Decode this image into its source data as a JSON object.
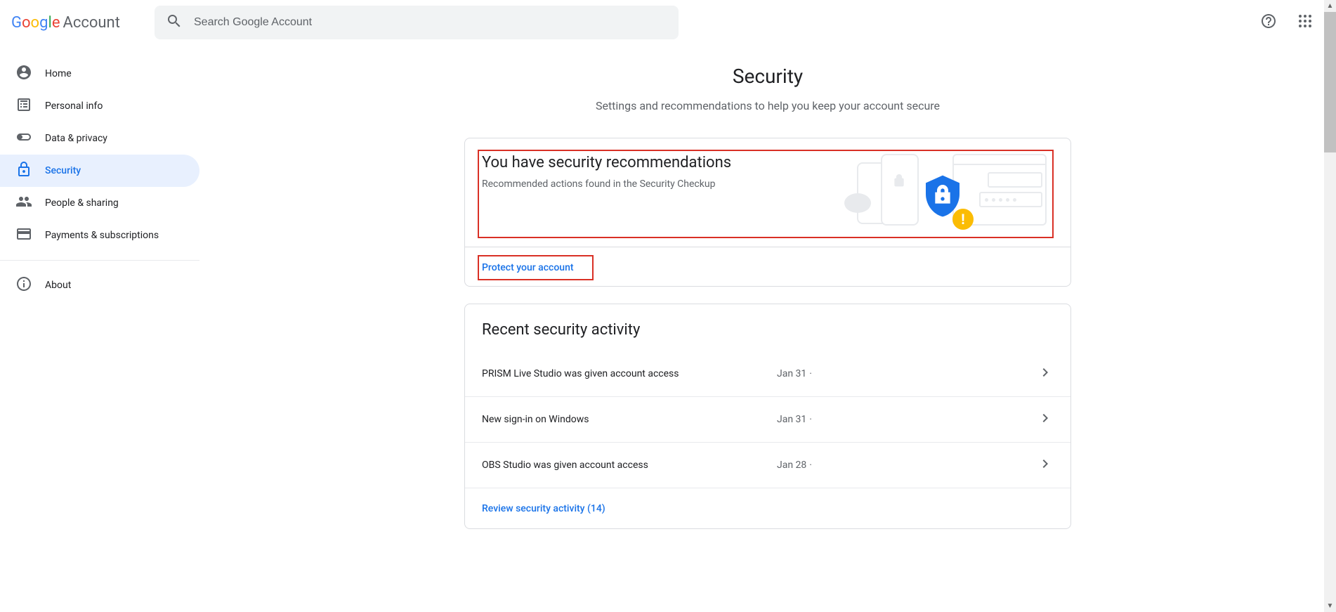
{
  "header": {
    "logo_letters": [
      "G",
      "o",
      "o",
      "g",
      "l",
      "e"
    ],
    "account_word": "Account",
    "search_placeholder": "Search Google Account"
  },
  "sidebar": {
    "items": [
      {
        "label": "Home"
      },
      {
        "label": "Personal info"
      },
      {
        "label": "Data & privacy"
      },
      {
        "label": "Security"
      },
      {
        "label": "People & sharing"
      },
      {
        "label": "Payments & subscriptions"
      }
    ],
    "about_label": "About"
  },
  "page": {
    "title": "Security",
    "subtitle": "Settings and recommendations to help you keep your account secure"
  },
  "recommendation": {
    "title": "You have security recommendations",
    "subtitle": "Recommended actions found in the Security Checkup",
    "cta": "Protect your account"
  },
  "activity": {
    "title": "Recent security activity",
    "rows": [
      {
        "desc": "PRISM Live Studio was given account access",
        "date": "Jan 31"
      },
      {
        "desc": "New sign-in on Windows",
        "date": "Jan 31"
      },
      {
        "desc": "OBS Studio was given account access",
        "date": "Jan 28"
      }
    ],
    "review_label": "Review security activity (14)"
  }
}
